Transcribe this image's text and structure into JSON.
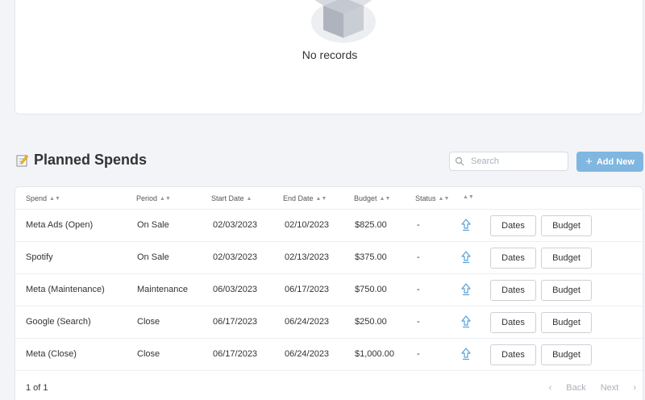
{
  "empty_state": {
    "message": "No records"
  },
  "section": {
    "title": "Planned Spends"
  },
  "search": {
    "placeholder": "Search"
  },
  "add_button": {
    "label": "Add New"
  },
  "table": {
    "columns": [
      "Spend",
      "Period",
      "Start Date",
      "End Date",
      "Budget",
      "Status",
      ""
    ],
    "rows": [
      {
        "spend": "Meta Ads (Open)",
        "period": "On Sale",
        "start": "02/03/2023",
        "end": "02/10/2023",
        "budget": "$825.00",
        "status": "-",
        "dates_label": "Dates",
        "budget_label": "Budget"
      },
      {
        "spend": "Spotify",
        "period": "On Sale",
        "start": "02/03/2023",
        "end": "02/13/2023",
        "budget": "$375.00",
        "status": "-",
        "dates_label": "Dates",
        "budget_label": "Budget"
      },
      {
        "spend": "Meta (Maintenance)",
        "period": "Maintenance",
        "start": "06/03/2023",
        "end": "06/17/2023",
        "budget": "$750.00",
        "status": "-",
        "dates_label": "Dates",
        "budget_label": "Budget"
      },
      {
        "spend": "Google (Search)",
        "period": "Close",
        "start": "06/17/2023",
        "end": "06/24/2023",
        "budget": "$250.00",
        "status": "-",
        "dates_label": "Dates",
        "budget_label": "Budget"
      },
      {
        "spend": "Meta (Close)",
        "period": "Close",
        "start": "06/17/2023",
        "end": "06/24/2023",
        "budget": "$1,000.00",
        "status": "-",
        "dates_label": "Dates",
        "budget_label": "Budget"
      }
    ]
  },
  "pagination": {
    "info": "1 of 1",
    "back": "Back",
    "next": "Next"
  },
  "colors": {
    "accent": "#7fb7e0",
    "background": "#f3f4f7",
    "icon_blue": "#5a9fd4"
  }
}
